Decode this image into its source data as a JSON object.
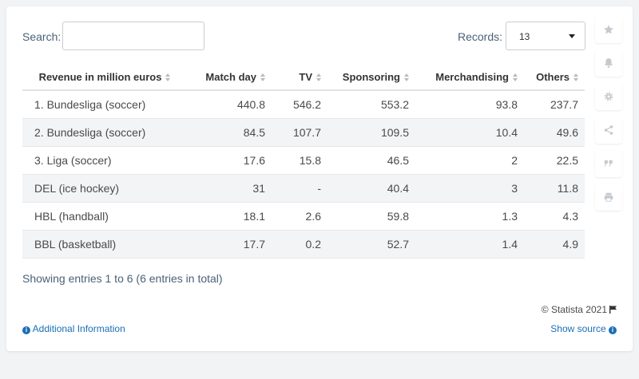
{
  "controls": {
    "search_label": "Search:",
    "search_value": "",
    "records_label": "Records:",
    "records_value": "13"
  },
  "table": {
    "headers": [
      "Revenue in million euros",
      "Match day",
      "TV",
      "Sponsoring",
      "Merchandising",
      "Others"
    ],
    "rows": [
      [
        "1. Bundesliga (soccer)",
        "440.8",
        "546.2",
        "553.2",
        "93.8",
        "237.7"
      ],
      [
        "2. Bundesliga (soccer)",
        "84.5",
        "107.7",
        "109.5",
        "10.4",
        "49.6"
      ],
      [
        "3. Liga (soccer)",
        "17.6",
        "15.8",
        "46.5",
        "2",
        "22.5"
      ],
      [
        "DEL (ice hockey)",
        "31",
        "-",
        "40.4",
        "3",
        "11.8"
      ],
      [
        "HBL (handball)",
        "18.1",
        "2.6",
        "59.8",
        "1.3",
        "4.3"
      ],
      [
        "BBL (basketball)",
        "17.7",
        "0.2",
        "52.7",
        "1.4",
        "4.9"
      ]
    ]
  },
  "footer": {
    "summary": "Showing entries 1 to 6 (6 entries in total)",
    "copyright": "© Statista 2021",
    "additional_info": "Additional Information",
    "show_source": "Show source"
  },
  "sidebar_icons": [
    "star-icon",
    "bell-icon",
    "gear-icon",
    "share-icon",
    "quote-icon",
    "print-icon"
  ],
  "colors": {
    "link": "#1a6fb6",
    "label": "#4a6178",
    "stripe": "#f2f4f6",
    "icon": "#c3c9cf"
  }
}
